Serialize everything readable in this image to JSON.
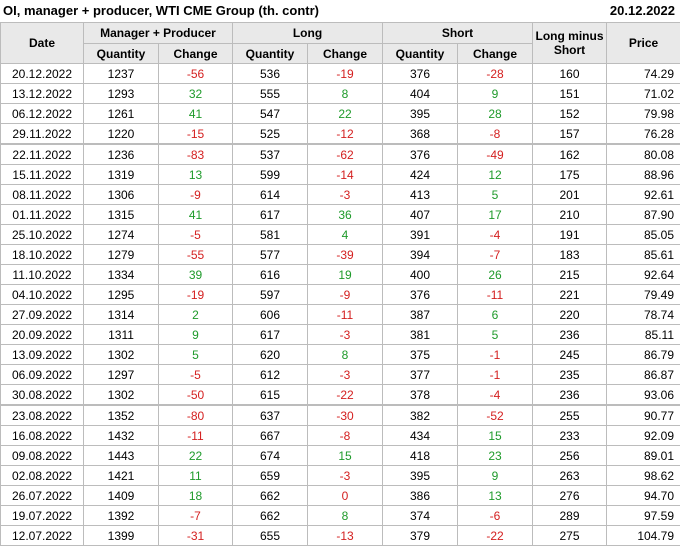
{
  "title": "OI, manager + producer, WTI CME Group (th. contr)",
  "report_date": "20.12.2022",
  "headers": {
    "date": "Date",
    "group1": "Manager + Producer",
    "group2": "Long",
    "group3": "Short",
    "long_minus_short": "Long minus Short",
    "price": "Price",
    "quantity": "Quantity",
    "change": "Change"
  },
  "rows": [
    {
      "date": "20.12.2022",
      "mp_q": "1237",
      "mp_c": "-56",
      "l_q": "536",
      "l_c": "-19",
      "s_q": "376",
      "s_c": "-28",
      "lms": "160",
      "price": "74.29"
    },
    {
      "date": "13.12.2022",
      "mp_q": "1293",
      "mp_c": "32",
      "l_q": "555",
      "l_c": "8",
      "s_q": "404",
      "s_c": "9",
      "lms": "151",
      "price": "71.02"
    },
    {
      "date": "06.12.2022",
      "mp_q": "1261",
      "mp_c": "41",
      "l_q": "547",
      "l_c": "22",
      "s_q": "395",
      "s_c": "28",
      "lms": "152",
      "price": "79.98"
    },
    {
      "date": "29.11.2022",
      "mp_q": "1220",
      "mp_c": "-15",
      "l_q": "525",
      "l_c": "-12",
      "s_q": "368",
      "s_c": "-8",
      "lms": "157",
      "price": "76.28"
    },
    {
      "date": "22.11.2022",
      "mp_q": "1236",
      "mp_c": "-83",
      "l_q": "537",
      "l_c": "-62",
      "s_q": "376",
      "s_c": "-49",
      "lms": "162",
      "price": "80.08"
    },
    {
      "date": "15.11.2022",
      "mp_q": "1319",
      "mp_c": "13",
      "l_q": "599",
      "l_c": "-14",
      "s_q": "424",
      "s_c": "12",
      "lms": "175",
      "price": "88.96"
    },
    {
      "date": "08.11.2022",
      "mp_q": "1306",
      "mp_c": "-9",
      "l_q": "614",
      "l_c": "-3",
      "s_q": "413",
      "s_c": "5",
      "lms": "201",
      "price": "92.61"
    },
    {
      "date": "01.11.2022",
      "mp_q": "1315",
      "mp_c": "41",
      "l_q": "617",
      "l_c": "36",
      "s_q": "407",
      "s_c": "17",
      "lms": "210",
      "price": "87.90"
    },
    {
      "date": "25.10.2022",
      "mp_q": "1274",
      "mp_c": "-5",
      "l_q": "581",
      "l_c": "4",
      "s_q": "391",
      "s_c": "-4",
      "lms": "191",
      "price": "85.05"
    },
    {
      "date": "18.10.2022",
      "mp_q": "1279",
      "mp_c": "-55",
      "l_q": "577",
      "l_c": "-39",
      "s_q": "394",
      "s_c": "-7",
      "lms": "183",
      "price": "85.61"
    },
    {
      "date": "11.10.2022",
      "mp_q": "1334",
      "mp_c": "39",
      "l_q": "616",
      "l_c": "19",
      "s_q": "400",
      "s_c": "26",
      "lms": "215",
      "price": "92.64"
    },
    {
      "date": "04.10.2022",
      "mp_q": "1295",
      "mp_c": "-19",
      "l_q": "597",
      "l_c": "-9",
      "s_q": "376",
      "s_c": "-11",
      "lms": "221",
      "price": "79.49"
    },
    {
      "date": "27.09.2022",
      "mp_q": "1314",
      "mp_c": "2",
      "l_q": "606",
      "l_c": "-11",
      "s_q": "387",
      "s_c": "6",
      "lms": "220",
      "price": "78.74"
    },
    {
      "date": "20.09.2022",
      "mp_q": "1311",
      "mp_c": "9",
      "l_q": "617",
      "l_c": "-3",
      "s_q": "381",
      "s_c": "5",
      "lms": "236",
      "price": "85.11"
    },
    {
      "date": "13.09.2022",
      "mp_q": "1302",
      "mp_c": "5",
      "l_q": "620",
      "l_c": "8",
      "s_q": "375",
      "s_c": "-1",
      "lms": "245",
      "price": "86.79"
    },
    {
      "date": "06.09.2022",
      "mp_q": "1297",
      "mp_c": "-5",
      "l_q": "612",
      "l_c": "-3",
      "s_q": "377",
      "s_c": "-1",
      "lms": "235",
      "price": "86.87"
    },
    {
      "date": "30.08.2022",
      "mp_q": "1302",
      "mp_c": "-50",
      "l_q": "615",
      "l_c": "-22",
      "s_q": "378",
      "s_c": "-4",
      "lms": "236",
      "price": "93.06"
    },
    {
      "date": "23.08.2022",
      "mp_q": "1352",
      "mp_c": "-80",
      "l_q": "637",
      "l_c": "-30",
      "s_q": "382",
      "s_c": "-52",
      "lms": "255",
      "price": "90.77"
    },
    {
      "date": "16.08.2022",
      "mp_q": "1432",
      "mp_c": "-11",
      "l_q": "667",
      "l_c": "-8",
      "s_q": "434",
      "s_c": "15",
      "lms": "233",
      "price": "92.09"
    },
    {
      "date": "09.08.2022",
      "mp_q": "1443",
      "mp_c": "22",
      "l_q": "674",
      "l_c": "15",
      "s_q": "418",
      "s_c": "23",
      "lms": "256",
      "price": "89.01"
    },
    {
      "date": "02.08.2022",
      "mp_q": "1421",
      "mp_c": "11",
      "l_q": "659",
      "l_c": "-3",
      "s_q": "395",
      "s_c": "9",
      "lms": "263",
      "price": "98.62"
    },
    {
      "date": "26.07.2022",
      "mp_q": "1409",
      "mp_c": "18",
      "l_q": "662",
      "l_c": "0",
      "s_q": "386",
      "s_c": "13",
      "lms": "276",
      "price": "94.70"
    },
    {
      "date": "19.07.2022",
      "mp_q": "1392",
      "mp_c": "-7",
      "l_q": "662",
      "l_c": "8",
      "s_q": "374",
      "s_c": "-6",
      "lms": "289",
      "price": "97.59"
    },
    {
      "date": "12.07.2022",
      "mp_q": "1399",
      "mp_c": "-31",
      "l_q": "655",
      "l_c": "-13",
      "s_q": "379",
      "s_c": "-22",
      "lms": "275",
      "price": "104.79"
    }
  ],
  "month_separator_before_rows": [
    4,
    17
  ],
  "colors": {
    "positive": "#1e9a2a",
    "negative": "#d42020",
    "header_bg": "#e9e9e9",
    "border": "#bcbcbc"
  }
}
